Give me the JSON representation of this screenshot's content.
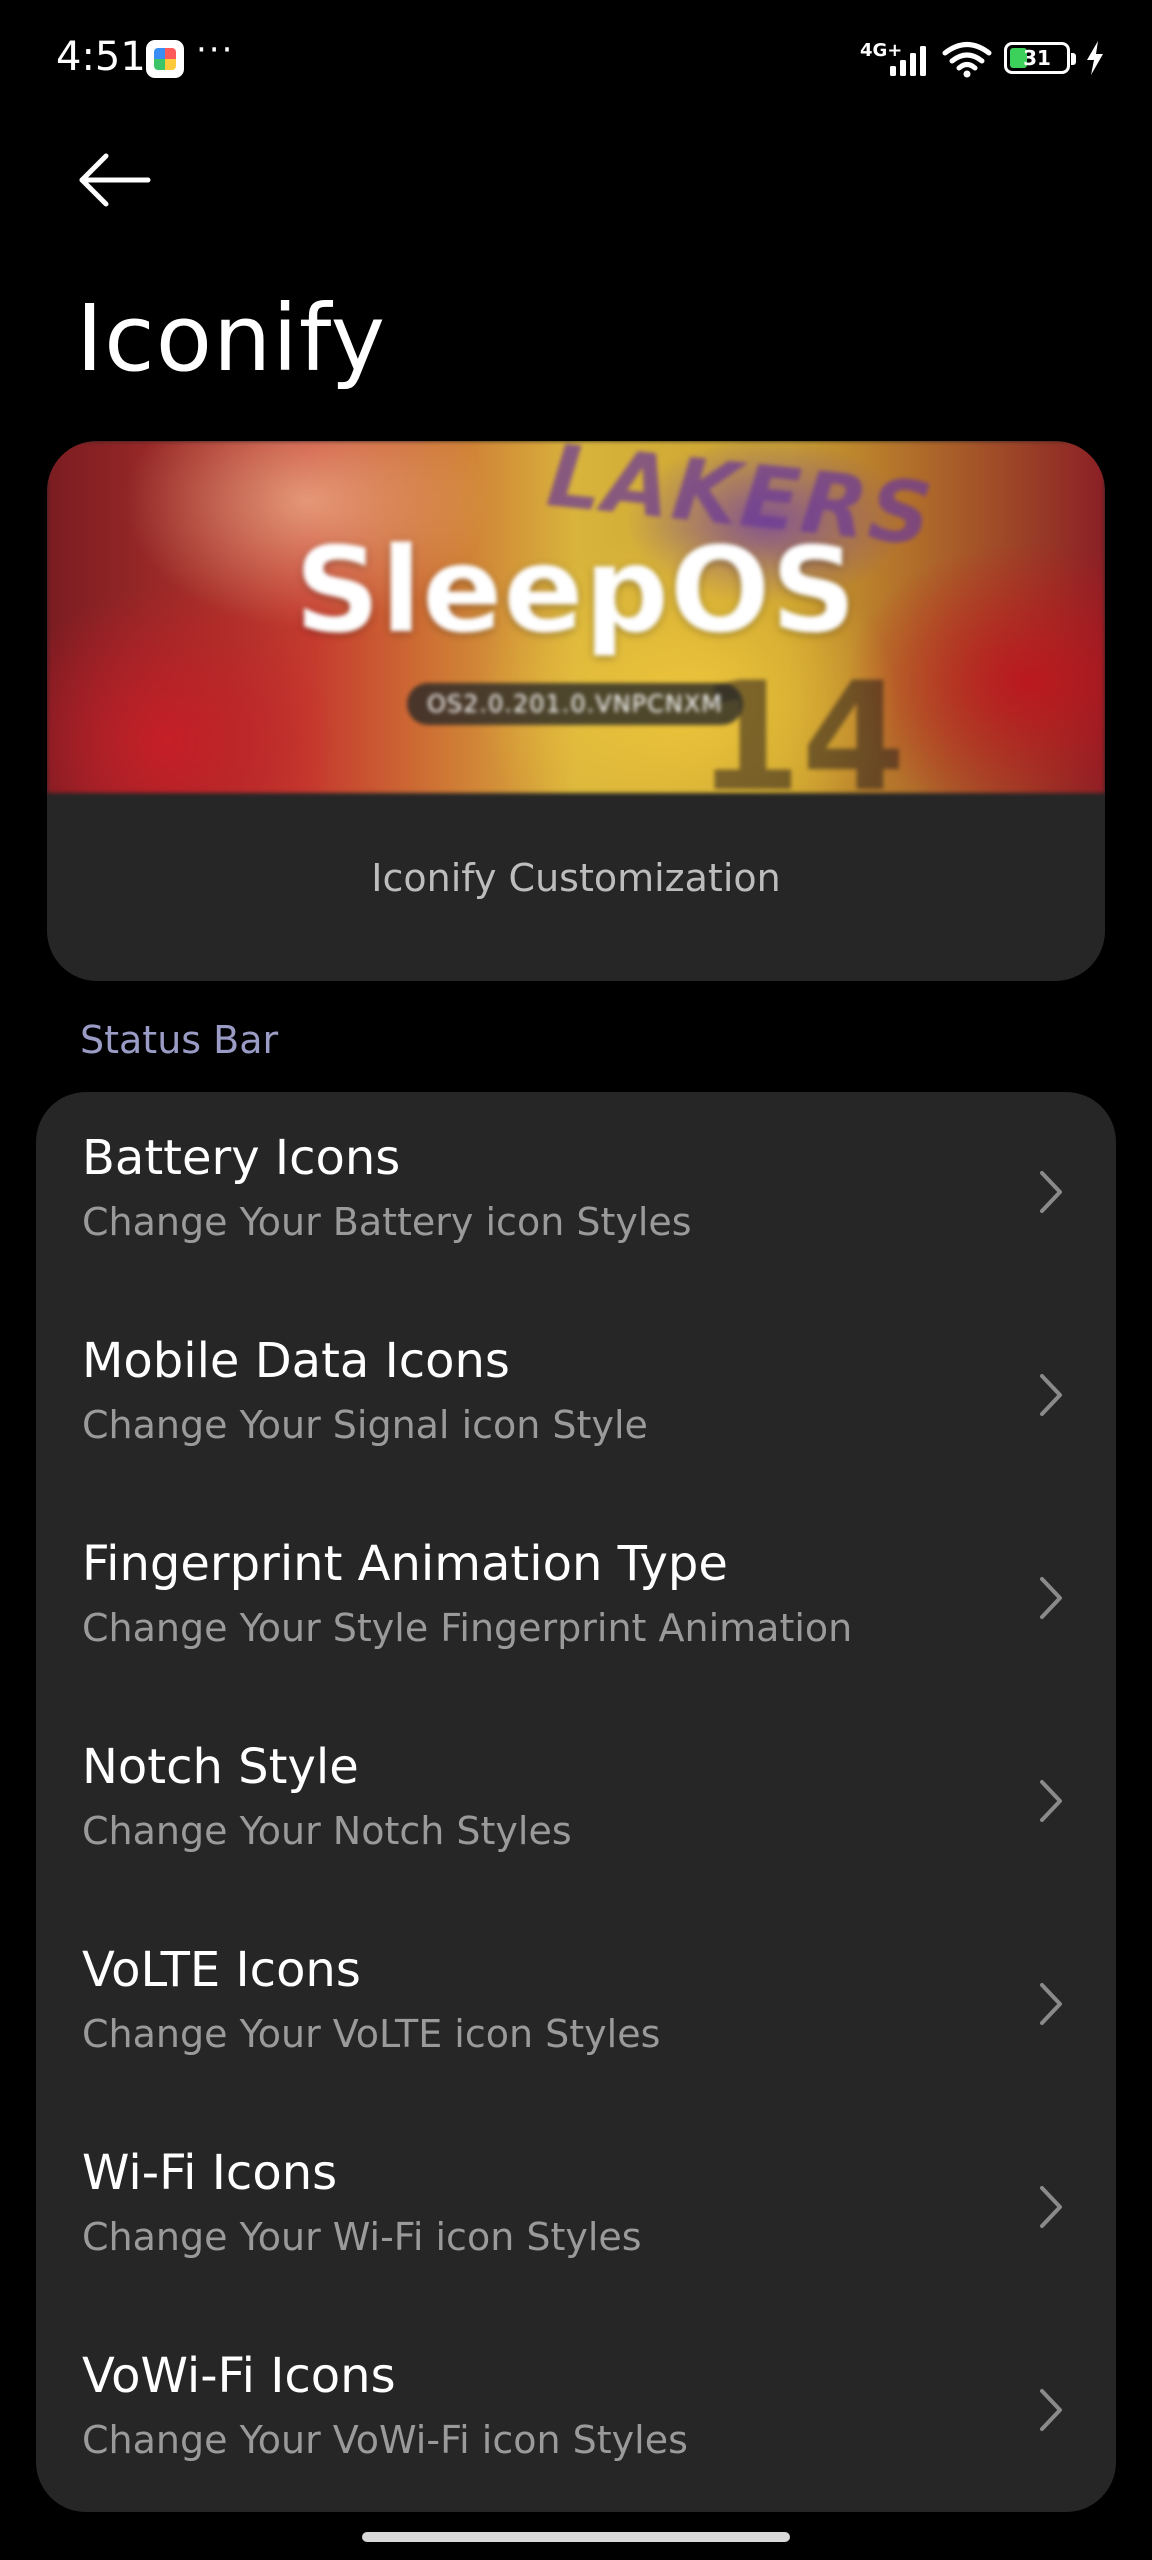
{
  "status_bar": {
    "time": "4:51",
    "overflow_dots": "···",
    "network_type": "4G+",
    "battery_level": "31",
    "battery_color": "#3cd15a",
    "app_icon": "colorful-app-icon",
    "signal_icon": "cellular-signal-icon",
    "wifi_icon": "wifi-icon",
    "charging_icon": "charging-bolt-icon"
  },
  "header": {
    "back_icon": "back-arrow-icon",
    "title": "Iconify"
  },
  "banner": {
    "logo_text": "SleepOS",
    "version": "OS2.0.201.0.VNPCNXM",
    "background_lettering": "LAKERS",
    "background_number": "14",
    "caption": "Iconify Customization"
  },
  "section": {
    "label": "Status Bar",
    "label_color": "#9a9cc6"
  },
  "items": [
    {
      "title": "Battery Icons",
      "subtitle": "Change Your Battery icon Styles"
    },
    {
      "title": "Mobile Data Icons",
      "subtitle": "Change Your Signal icon Style"
    },
    {
      "title": "Fingerprint Animation Type",
      "subtitle": "Change Your Style Fingerprint Animation"
    },
    {
      "title": "Notch Style",
      "subtitle": "Change Your Notch Styles"
    },
    {
      "title": "VoLTE Icons",
      "subtitle": "Change Your VoLTE icon Styles"
    },
    {
      "title": "Wi-Fi Icons",
      "subtitle": "Change Your Wi-Fi icon Styles"
    },
    {
      "title": "VoWi-Fi Icons",
      "subtitle": "Change Your VoWi-Fi icon Styles"
    }
  ]
}
